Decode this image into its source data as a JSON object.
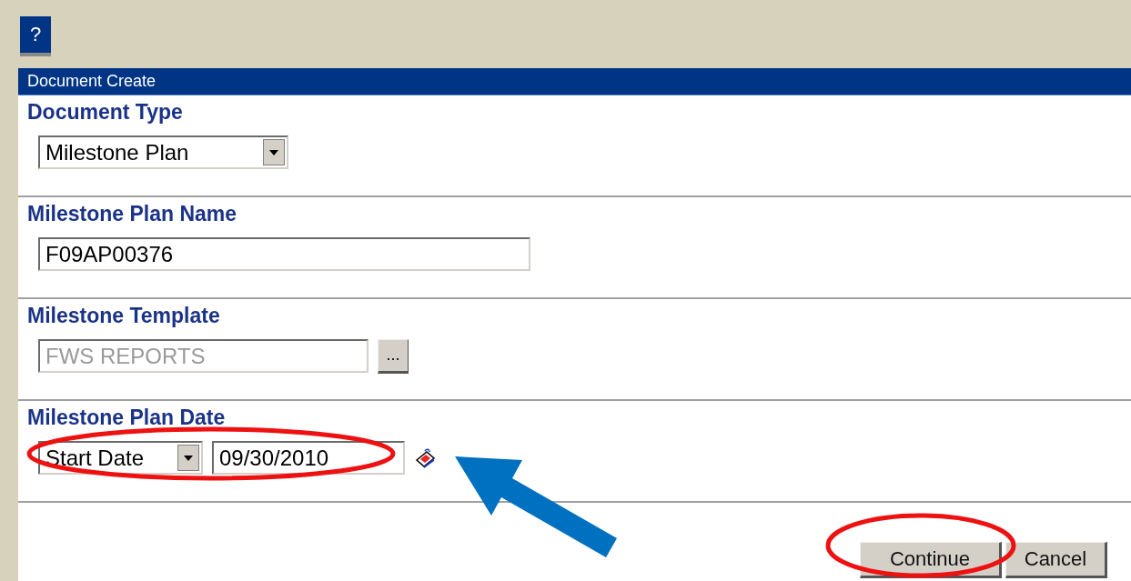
{
  "toolbar": {
    "help_button": "?"
  },
  "panel": {
    "title": "Document Create"
  },
  "sections": [
    {
      "label": "Document Type",
      "kind": "select",
      "value": "Milestone Plan"
    },
    {
      "label": "Milestone Plan Name",
      "kind": "text",
      "value": "F09AP00376"
    },
    {
      "label": "Milestone Template",
      "kind": "lookup",
      "value": "FWS REPORTS",
      "disabled": true,
      "button": "..."
    },
    {
      "label": "Milestone Plan Date",
      "kind": "date",
      "select_value": "Start Date",
      "value": "09/30/2010"
    }
  ],
  "buttons": [
    {
      "label": "Continue",
      "kind": "continue"
    },
    {
      "label": "Cancel",
      "kind": "cancel"
    }
  ],
  "annotations": [
    {
      "kind": "ellipse",
      "color": "#ee1111"
    },
    {
      "kind": "ellipse",
      "color": "#ee1111"
    },
    {
      "kind": "arrow",
      "color": "#0070c0"
    }
  ]
}
